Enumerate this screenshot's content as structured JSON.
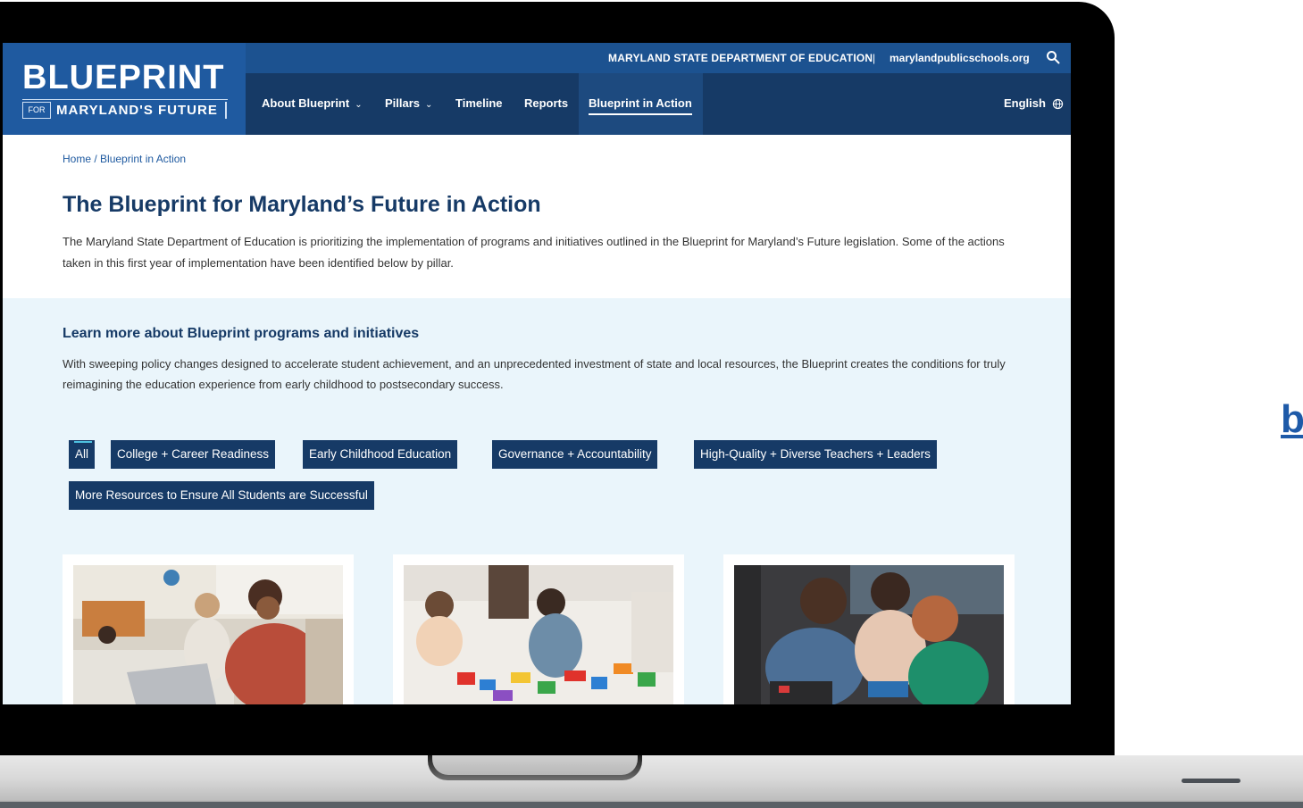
{
  "side_link_text": "b",
  "header": {
    "logo_main": "BLUEPRINT",
    "logo_for": "FOR",
    "logo_sub": "MARYLAND'S FUTURE",
    "top_msde": "MARYLAND STATE DEPARTMENT OF EDUCATION",
    "top_sep": "|",
    "top_site": "marylandpublicschools.org",
    "search_icon": "search-icon",
    "nav": [
      {
        "label": "About Blueprint",
        "chevron": "⌄"
      },
      {
        "label": "Pillars",
        "chevron": "⌄"
      },
      {
        "label": "Timeline"
      },
      {
        "label": "Reports"
      },
      {
        "label": "Blueprint in Action"
      }
    ],
    "language": "English",
    "language_icon": "globe-icon"
  },
  "breadcrumb": {
    "home": "Home",
    "sep": " / ",
    "current": "Blueprint in Action"
  },
  "page_title": "The Blueprint for Maryland’s Future in Action",
  "intro_text": "The Maryland State Department of Education is prioritizing the implementation of programs and initiatives outlined in the Blueprint for Maryland’s Future legislation. Some of the actions taken in this first year of implementation have been identified below by pillar.",
  "section": {
    "title": "Learn more about Blueprint programs and initiatives",
    "text": "With sweeping policy changes designed to accelerate student achievement, and an unprecedented investment of state and local resources, the Blueprint creates the conditions for truly reimagining the education experience from early childhood to postsecondary success."
  },
  "filters": [
    "All",
    "College + Career Readiness",
    "Early Childhood Education",
    "Governance + Accountability",
    "High-Quality + Diverse Teachers + Leaders",
    "More Resources to Ensure All Students are Successful"
  ],
  "colors": {
    "brand_navy": "#163a66",
    "brand_blue": "#1f5aa0",
    "top_bar": "#1c5290",
    "section_bg": "#eaf5fb",
    "active_mark": "#4ec1e0"
  }
}
